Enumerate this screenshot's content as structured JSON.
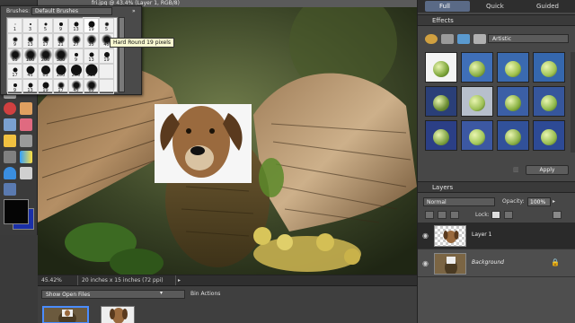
{
  "document": {
    "title": "fri.jpg @ 43.4% (Layer 1, RGB/8)",
    "zoom": "45.42%",
    "doc_size": "20 inches x 15 inches (72 ppi)",
    "status_arrow": "▸"
  },
  "brush_picker": {
    "label": "Brushes:",
    "selected_set": "Default Brushes",
    "menu_icon": "double-arrow-icon",
    "tooltip": "Hard Round 19 pixels",
    "brushes": [
      {
        "num": "1",
        "size": 1,
        "soft": false
      },
      {
        "num": "3",
        "size": 2,
        "soft": false
      },
      {
        "num": "5",
        "size": 3,
        "soft": false
      },
      {
        "num": "9",
        "size": 4,
        "soft": false
      },
      {
        "num": "13",
        "size": 5,
        "soft": false
      },
      {
        "num": "19",
        "size": 7,
        "soft": false
      },
      {
        "num": "5",
        "size": 3,
        "soft": true
      },
      {
        "num": "9",
        "size": 4,
        "soft": true
      },
      {
        "num": "13",
        "size": 5,
        "soft": true
      },
      {
        "num": "17",
        "size": 6,
        "soft": true
      },
      {
        "num": "21",
        "size": 7,
        "soft": true
      },
      {
        "num": "27",
        "size": 8,
        "soft": true
      },
      {
        "num": "35",
        "size": 9,
        "soft": true
      },
      {
        "num": "45",
        "size": 10,
        "soft": true
      },
      {
        "num": "65",
        "size": 11,
        "soft": true
      },
      {
        "num": "100",
        "size": 12,
        "soft": true
      },
      {
        "num": "200",
        "size": 12,
        "soft": true
      },
      {
        "num": "300",
        "size": 13,
        "soft": true
      },
      {
        "num": "9",
        "size": 4,
        "soft": false
      },
      {
        "num": "13",
        "size": 5,
        "soft": false
      },
      {
        "num": "19",
        "size": 6,
        "soft": false
      },
      {
        "num": "17",
        "size": 5,
        "soft": false
      },
      {
        "num": "45",
        "size": 9,
        "soft": false
      },
      {
        "num": "65",
        "size": 10,
        "soft": false
      },
      {
        "num": "100",
        "size": 11,
        "soft": false
      },
      {
        "num": "200",
        "size": 12,
        "soft": false
      },
      {
        "num": "300",
        "size": 13,
        "soft": false
      },
      {
        "num": "",
        "size": 0,
        "soft": false
      },
      {
        "num": "9",
        "size": 4,
        "soft": false
      },
      {
        "num": "13",
        "size": 5,
        "soft": false
      },
      {
        "num": "19",
        "size": 7,
        "soft": false
      },
      {
        "num": "17",
        "size": 6,
        "soft": true
      },
      {
        "num": "45",
        "size": 9,
        "soft": true
      },
      {
        "num": "65",
        "size": 10,
        "soft": true
      },
      {
        "num": "",
        "size": 0,
        "soft": false
      }
    ]
  },
  "project_bin": {
    "show": "Show Open Files",
    "actions": "Bin Actions"
  },
  "modes": {
    "full": "Full",
    "quick": "Quick",
    "guided": "Guided"
  },
  "effects": {
    "title": "Effects",
    "category": "Artistic",
    "apply": "Apply",
    "tiles": [
      {
        "bg": "#f4f4f4",
        "apple": "#7ea63a"
      },
      {
        "bg": "#3f6fb8",
        "apple": "#8bb046"
      },
      {
        "bg": "#3a6ab0",
        "apple": "#9fc04a"
      },
      {
        "bg": "#3567ad",
        "apple": "#a1c455"
      },
      {
        "bg": "#2a3f78",
        "apple": "#6c8e34"
      },
      {
        "bg": "#b7bfcc",
        "apple": "#9cbf55"
      },
      {
        "bg": "#3b5fa6",
        "apple": "#88b040"
      },
      {
        "bg": "#36569c",
        "apple": "#8fb94c"
      },
      {
        "bg": "#2b3f86",
        "apple": "#7fa343"
      },
      {
        "bg": "#3c58a2",
        "apple": "#a3c95a"
      },
      {
        "bg": "#31519a",
        "apple": "#8db24a"
      },
      {
        "bg": "#2d4a95",
        "apple": "#98bd50"
      }
    ]
  },
  "layers": {
    "title": "Layers",
    "blend_mode": "Normal",
    "opacity_label": "Opacity:",
    "opacity": "100%",
    "lock_label": "Lock:",
    "items": [
      {
        "name": "Layer 1"
      },
      {
        "name": "Background"
      }
    ]
  }
}
